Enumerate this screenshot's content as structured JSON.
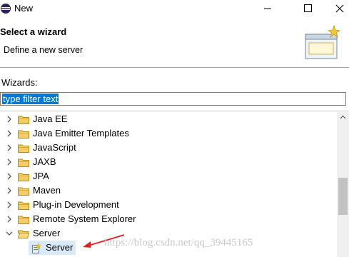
{
  "window": {
    "title": "New"
  },
  "header": {
    "title": "Select a wizard",
    "description": "Define a new server"
  },
  "wizards": {
    "label": "Wizards:",
    "filter_value": "type filter text"
  },
  "tree": {
    "items": [
      {
        "label": "Java EE",
        "expanded": false
      },
      {
        "label": "Java Emitter Templates",
        "expanded": false
      },
      {
        "label": "JavaScript",
        "expanded": false
      },
      {
        "label": "JAXB",
        "expanded": false
      },
      {
        "label": "JPA",
        "expanded": false
      },
      {
        "label": "Maven",
        "expanded": false
      },
      {
        "label": "Plug-in Development",
        "expanded": false
      },
      {
        "label": "Remote System Explorer",
        "expanded": false
      },
      {
        "label": "Server",
        "expanded": true
      }
    ],
    "selected_child": {
      "label": "Server"
    }
  },
  "watermark": {
    "text": "https://blog.csdn.net/qq_39445165"
  },
  "colors": {
    "selection": "#0078d7",
    "folder": "#e8b84a",
    "annotation_arrow": "#e02020"
  }
}
